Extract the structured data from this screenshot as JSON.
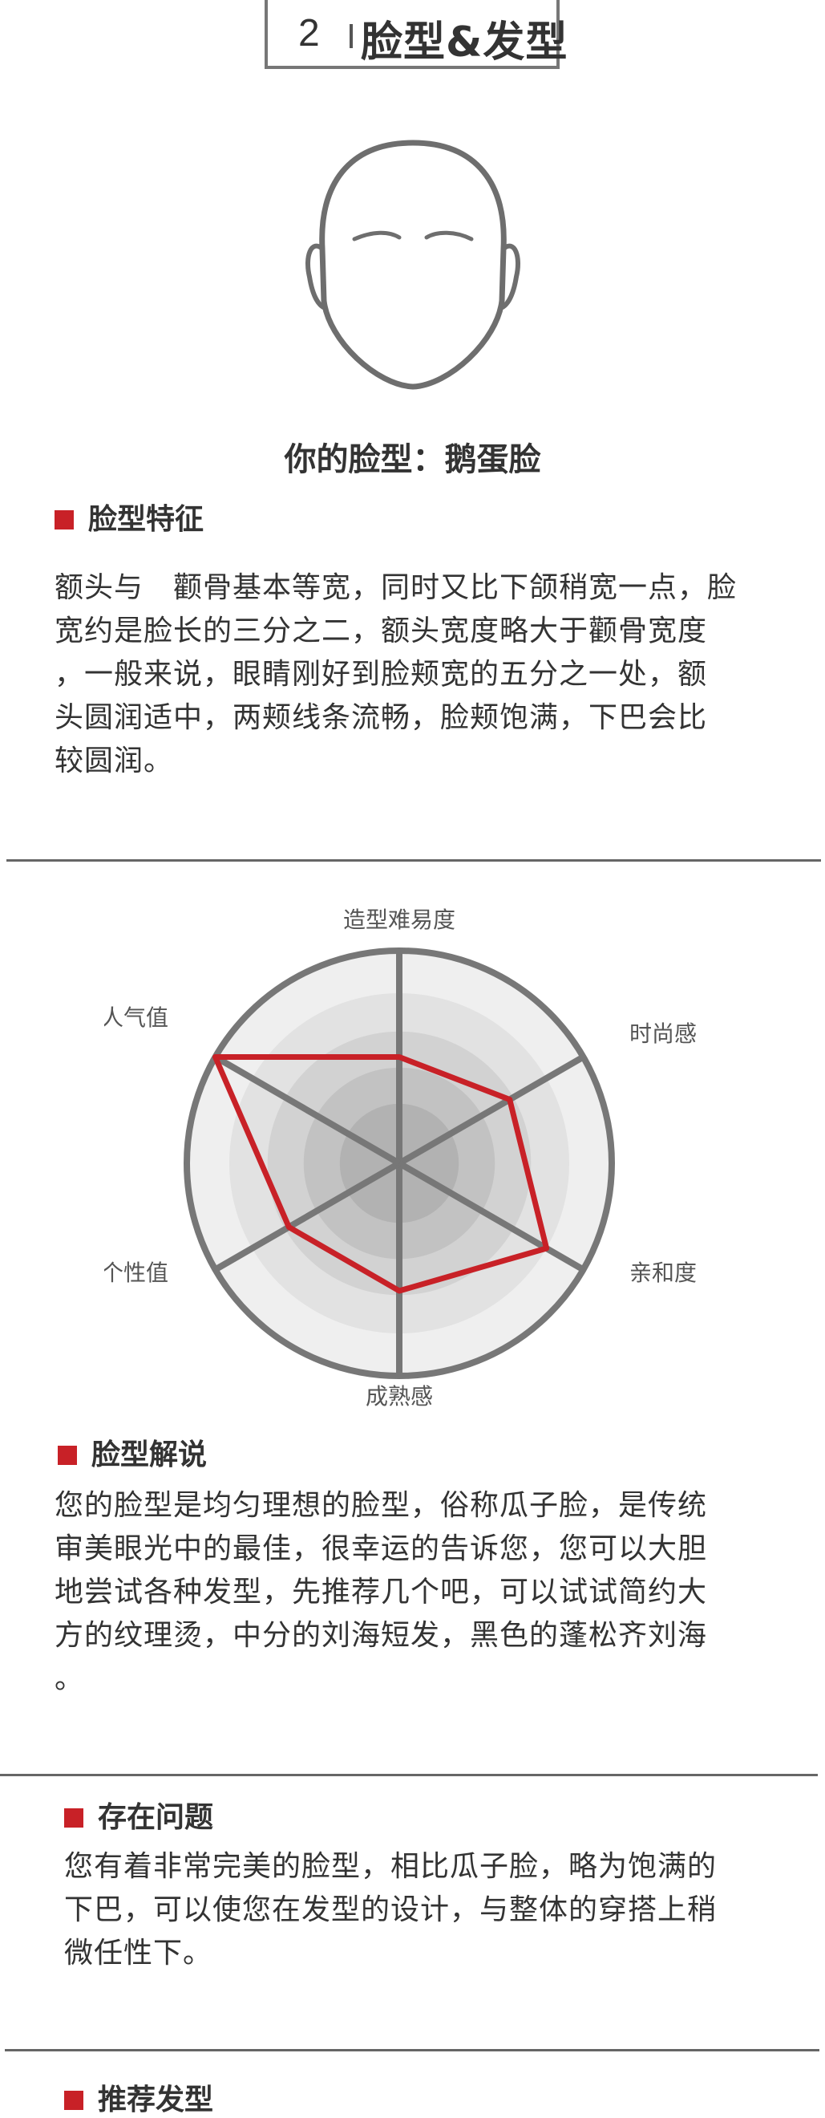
{
  "header": {
    "number": "2",
    "title": "脸型&发型"
  },
  "face": {
    "label": "你的脸型：",
    "value": "鹅蛋脸"
  },
  "features": {
    "heading": "脸型特征",
    "text": "额头与　颧骨基本等宽，同时又比下颌稍宽一点，脸\n宽约是脸长的三分之二，额头宽度略大于颧骨宽度\n，一般来说，眼睛刚好到脸颊宽的五分之一处，额\n头圆润适中，两颊线条流畅，脸颊饱满，下巴会比\n较圆润。"
  },
  "chart_data": {
    "type": "radar",
    "axes": [
      "造型难易度",
      "时尚感",
      "亲和度",
      "成熟感",
      "个性值",
      "人气值"
    ],
    "values": [
      0.5,
      0.6,
      0.8,
      0.6,
      0.6,
      1.0
    ],
    "range": [
      0,
      1
    ],
    "colors": {
      "line": "#c82127",
      "grid": "#777777"
    }
  },
  "interpretation": {
    "heading": "脸型解说",
    "text": "您的脸型是均匀理想的脸型，俗称瓜子脸，是传统\n审美眼光中的最佳，很幸运的告诉您，您可以大胆\n地尝试各种发型，先推荐几个吧，可以试试简约大\n方的纹理烫，中分的刘海短发，黑色的蓬松齐刘海\n。"
  },
  "problems": {
    "heading": "存在问题",
    "text": "您有着非常完美的脸型，相比瓜子脸，略为饱满的\n下巴，可以使您在发型的设计，与整体的穿搭上稍\n微任性下。"
  },
  "recommend": {
    "heading": "推荐发型"
  },
  "colors": {
    "accent": "#c82127",
    "text": "#333333",
    "rule": "#666666"
  }
}
